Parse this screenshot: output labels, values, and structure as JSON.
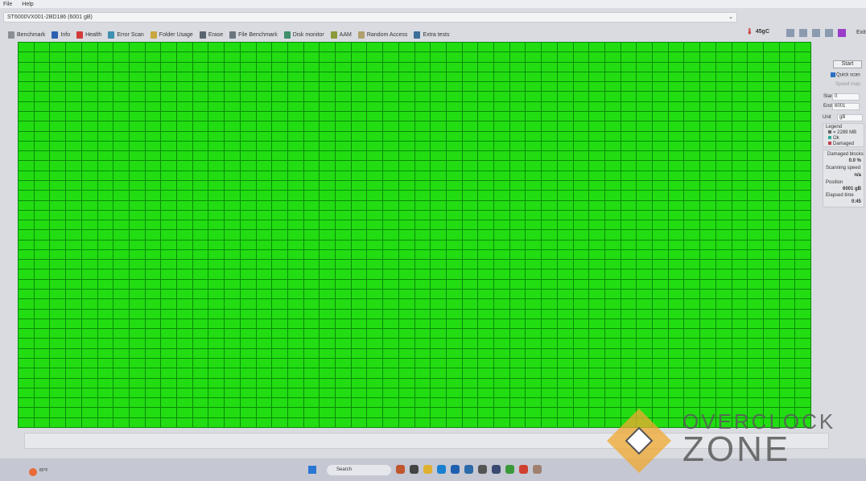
{
  "menu": [
    "File",
    "Help"
  ],
  "drive": "ST6000VX001-2BD186 (6001 gB)",
  "temperature": "45gC",
  "exit_label": "Exit",
  "tabs": [
    {
      "label": "Benchmark",
      "color": "#8a8f96"
    },
    {
      "label": "Info",
      "color": "#2c5fb0"
    },
    {
      "label": "Health",
      "color": "#d23a3a"
    },
    {
      "label": "Error Scan",
      "color": "#3f8fb0"
    },
    {
      "label": "Folder Usage",
      "color": "#c9a640"
    },
    {
      "label": "Erase",
      "color": "#5a6470"
    },
    {
      "label": "File Benchmark",
      "color": "#6a7580"
    },
    {
      "label": "Disk monitor",
      "color": "#3c8f6a"
    },
    {
      "label": "AAM",
      "color": "#8c9a3a"
    },
    {
      "label": "Random Access",
      "color": "#b0a070"
    },
    {
      "label": "Extra tests",
      "color": "#3c6f9a"
    }
  ],
  "panel": {
    "start_button": "Start",
    "quick_scan": "Quick scan",
    "speed_map": "Speed map",
    "start_label": "Start",
    "start_value": "0",
    "end_label": "End",
    "end_value": "6001",
    "unit_label": "Unit",
    "unit_value": "gB",
    "legend_title": "Legend",
    "legend_block": "= 2289 MB",
    "legend_ok": "Ok",
    "legend_damaged": "Damaged",
    "damaged_label": "Damaged blocks",
    "damaged_value": "0.0 %",
    "speed_label": "Scanning speed",
    "speed_value": "n/a",
    "position_label": "Position",
    "position_value": "6001 gB",
    "elapsed_label": "Elapsed time",
    "elapsed_value": "0:45"
  },
  "colors": {
    "ok": "#22dd12",
    "damaged": "#c04050"
  },
  "taskbar": {
    "search": "Search",
    "weather": "80°F"
  },
  "watermark": {
    "line1": "OVERCLOCK",
    "line2": "ZONE"
  }
}
